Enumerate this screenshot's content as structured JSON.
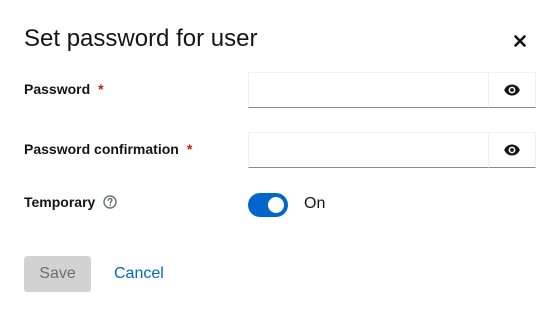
{
  "modal": {
    "title": "Set password for user",
    "close_icon": "close-icon"
  },
  "form": {
    "password": {
      "label": "Password",
      "required_mark": "*",
      "value": "",
      "toggle_icon": "eye-icon"
    },
    "password_confirmation": {
      "label": "Password confirmation",
      "required_mark": "*",
      "value": "",
      "toggle_icon": "eye-icon"
    },
    "temporary": {
      "label": "Temporary",
      "help_icon": "help-icon",
      "state": "On",
      "enabled": true
    }
  },
  "actions": {
    "save_label": "Save",
    "cancel_label": "Cancel"
  },
  "colors": {
    "accent": "#0066cc",
    "required": "#c9190b",
    "disabled_bg": "#d2d2d2"
  }
}
